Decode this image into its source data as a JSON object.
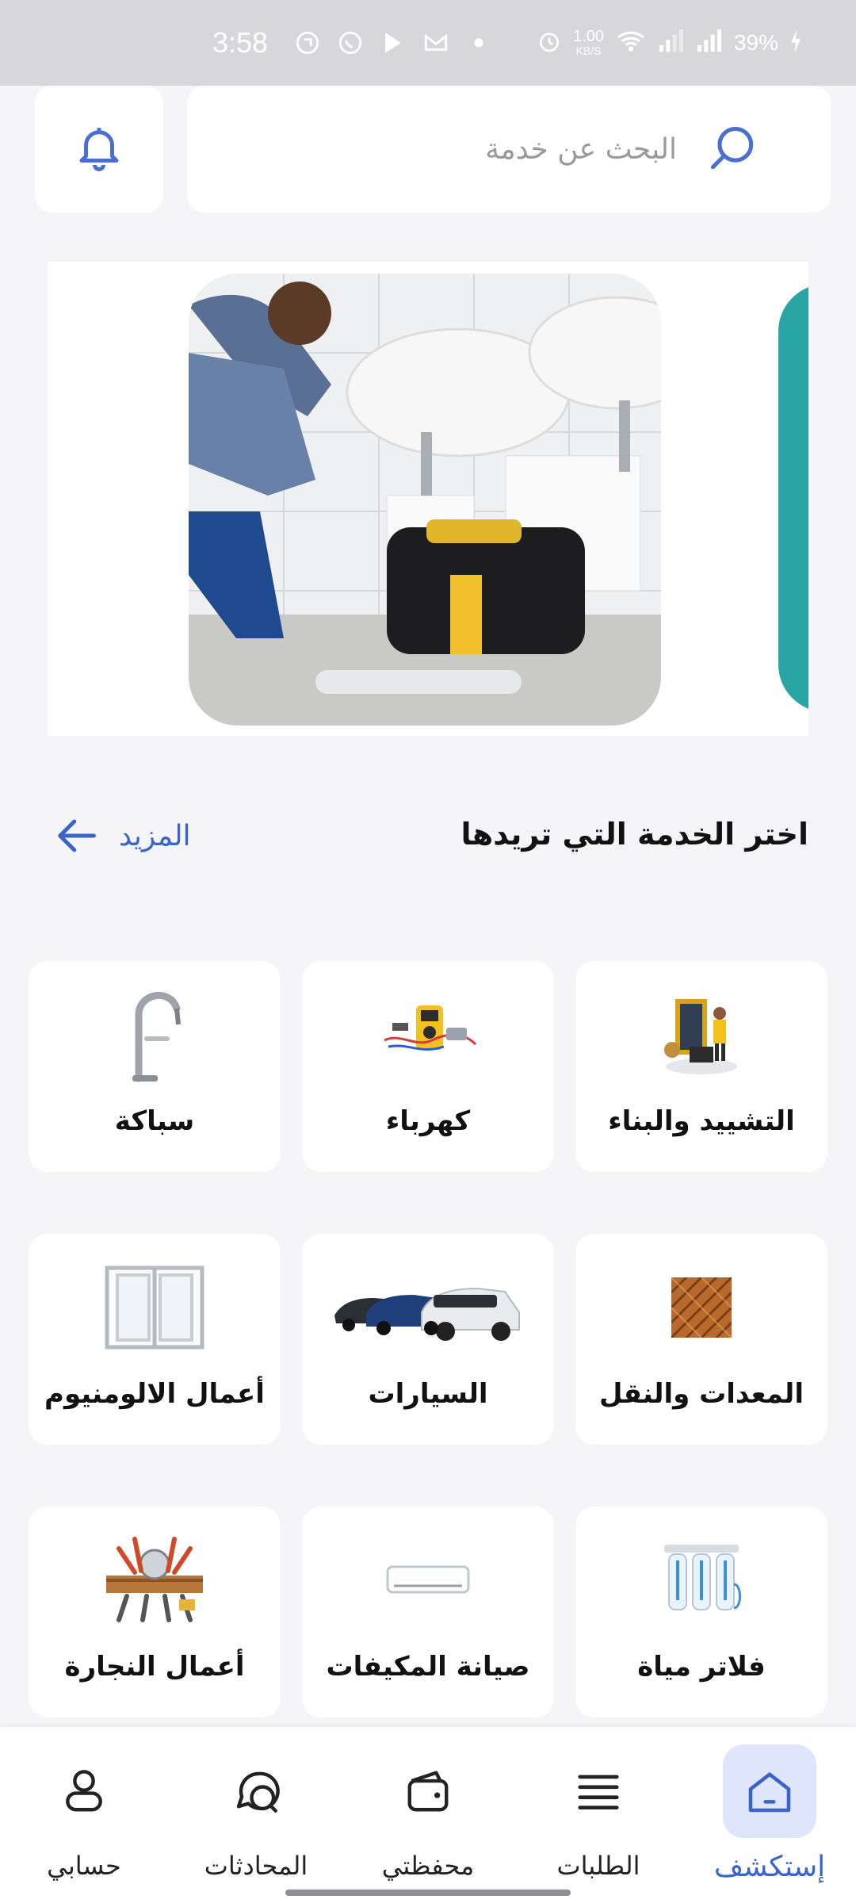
{
  "status_bar": {
    "time": "3:58",
    "net_speed_value": "1.00",
    "net_speed_unit": "KB/S",
    "battery": "39%"
  },
  "search": {
    "placeholder": "البحث عن خدمة"
  },
  "section": {
    "title": "اختر الخدمة التي تريدها",
    "more_label": "المزيد"
  },
  "services": [
    {
      "label": "التشييد والبناء",
      "icon": "construction-workers-icon"
    },
    {
      "label": "كهرباء",
      "icon": "electrical-tools-icon"
    },
    {
      "label": "سباكة",
      "icon": "faucet-icon"
    },
    {
      "label": "المعدات والنقل",
      "icon": "wood-floor-icon"
    },
    {
      "label": "السيارات",
      "icon": "cars-icon"
    },
    {
      "label": "أعمال الالومنيوم",
      "icon": "aluminum-window-icon"
    },
    {
      "label": "فلاتر مياة",
      "icon": "water-filter-icon"
    },
    {
      "label": "صيانة المكيفات",
      "icon": "air-conditioner-icon"
    },
    {
      "label": "أعمال النجارة",
      "icon": "carpentry-tools-icon"
    }
  ],
  "bottom_nav": [
    {
      "label": "إستكشف",
      "icon": "home-icon",
      "active": true
    },
    {
      "label": "الطلبات",
      "icon": "list-icon",
      "active": false
    },
    {
      "label": "محفظتي",
      "icon": "wallet-icon",
      "active": false
    },
    {
      "label": "المحادثات",
      "icon": "chat-icon",
      "active": false
    },
    {
      "label": "حسابي",
      "icon": "user-icon",
      "active": false
    }
  ],
  "colors": {
    "accent": "#3b64c8",
    "active_nav_bg": "#dfe6fb",
    "background": "#f5f5f7",
    "status_bar": "#d7d7d9"
  }
}
